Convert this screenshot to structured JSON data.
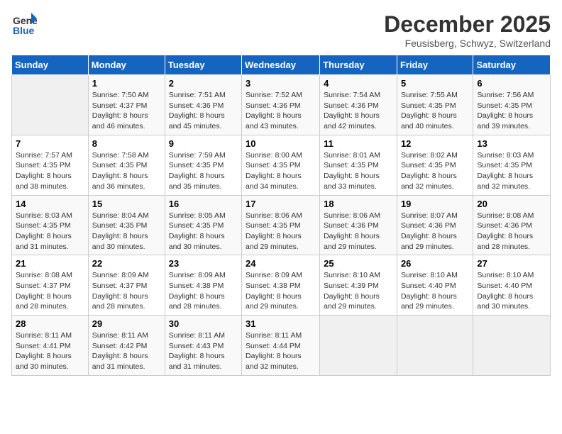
{
  "header": {
    "logo_general": "General",
    "logo_blue": "Blue",
    "month": "December 2025",
    "location": "Feusisberg, Schwyz, Switzerland"
  },
  "days_of_week": [
    "Sunday",
    "Monday",
    "Tuesday",
    "Wednesday",
    "Thursday",
    "Friday",
    "Saturday"
  ],
  "weeks": [
    [
      {
        "day": "",
        "info": ""
      },
      {
        "day": "1",
        "info": "Sunrise: 7:50 AM\nSunset: 4:37 PM\nDaylight: 8 hours\nand 46 minutes."
      },
      {
        "day": "2",
        "info": "Sunrise: 7:51 AM\nSunset: 4:36 PM\nDaylight: 8 hours\nand 45 minutes."
      },
      {
        "day": "3",
        "info": "Sunrise: 7:52 AM\nSunset: 4:36 PM\nDaylight: 8 hours\nand 43 minutes."
      },
      {
        "day": "4",
        "info": "Sunrise: 7:54 AM\nSunset: 4:36 PM\nDaylight: 8 hours\nand 42 minutes."
      },
      {
        "day": "5",
        "info": "Sunrise: 7:55 AM\nSunset: 4:35 PM\nDaylight: 8 hours\nand 40 minutes."
      },
      {
        "day": "6",
        "info": "Sunrise: 7:56 AM\nSunset: 4:35 PM\nDaylight: 8 hours\nand 39 minutes."
      }
    ],
    [
      {
        "day": "7",
        "info": "Sunrise: 7:57 AM\nSunset: 4:35 PM\nDaylight: 8 hours\nand 38 minutes."
      },
      {
        "day": "8",
        "info": "Sunrise: 7:58 AM\nSunset: 4:35 PM\nDaylight: 8 hours\nand 36 minutes."
      },
      {
        "day": "9",
        "info": "Sunrise: 7:59 AM\nSunset: 4:35 PM\nDaylight: 8 hours\nand 35 minutes."
      },
      {
        "day": "10",
        "info": "Sunrise: 8:00 AM\nSunset: 4:35 PM\nDaylight: 8 hours\nand 34 minutes."
      },
      {
        "day": "11",
        "info": "Sunrise: 8:01 AM\nSunset: 4:35 PM\nDaylight: 8 hours\nand 33 minutes."
      },
      {
        "day": "12",
        "info": "Sunrise: 8:02 AM\nSunset: 4:35 PM\nDaylight: 8 hours\nand 32 minutes."
      },
      {
        "day": "13",
        "info": "Sunrise: 8:03 AM\nSunset: 4:35 PM\nDaylight: 8 hours\nand 32 minutes."
      }
    ],
    [
      {
        "day": "14",
        "info": "Sunrise: 8:03 AM\nSunset: 4:35 PM\nDaylight: 8 hours\nand 31 minutes."
      },
      {
        "day": "15",
        "info": "Sunrise: 8:04 AM\nSunset: 4:35 PM\nDaylight: 8 hours\nand 30 minutes."
      },
      {
        "day": "16",
        "info": "Sunrise: 8:05 AM\nSunset: 4:35 PM\nDaylight: 8 hours\nand 30 minutes."
      },
      {
        "day": "17",
        "info": "Sunrise: 8:06 AM\nSunset: 4:35 PM\nDaylight: 8 hours\nand 29 minutes."
      },
      {
        "day": "18",
        "info": "Sunrise: 8:06 AM\nSunset: 4:36 PM\nDaylight: 8 hours\nand 29 minutes."
      },
      {
        "day": "19",
        "info": "Sunrise: 8:07 AM\nSunset: 4:36 PM\nDaylight: 8 hours\nand 29 minutes."
      },
      {
        "day": "20",
        "info": "Sunrise: 8:08 AM\nSunset: 4:36 PM\nDaylight: 8 hours\nand 28 minutes."
      }
    ],
    [
      {
        "day": "21",
        "info": "Sunrise: 8:08 AM\nSunset: 4:37 PM\nDaylight: 8 hours\nand 28 minutes."
      },
      {
        "day": "22",
        "info": "Sunrise: 8:09 AM\nSunset: 4:37 PM\nDaylight: 8 hours\nand 28 minutes."
      },
      {
        "day": "23",
        "info": "Sunrise: 8:09 AM\nSunset: 4:38 PM\nDaylight: 8 hours\nand 28 minutes."
      },
      {
        "day": "24",
        "info": "Sunrise: 8:09 AM\nSunset: 4:38 PM\nDaylight: 8 hours\nand 29 minutes."
      },
      {
        "day": "25",
        "info": "Sunrise: 8:10 AM\nSunset: 4:39 PM\nDaylight: 8 hours\nand 29 minutes."
      },
      {
        "day": "26",
        "info": "Sunrise: 8:10 AM\nSunset: 4:40 PM\nDaylight: 8 hours\nand 29 minutes."
      },
      {
        "day": "27",
        "info": "Sunrise: 8:10 AM\nSunset: 4:40 PM\nDaylight: 8 hours\nand 30 minutes."
      }
    ],
    [
      {
        "day": "28",
        "info": "Sunrise: 8:11 AM\nSunset: 4:41 PM\nDaylight: 8 hours\nand 30 minutes."
      },
      {
        "day": "29",
        "info": "Sunrise: 8:11 AM\nSunset: 4:42 PM\nDaylight: 8 hours\nand 31 minutes."
      },
      {
        "day": "30",
        "info": "Sunrise: 8:11 AM\nSunset: 4:43 PM\nDaylight: 8 hours\nand 31 minutes."
      },
      {
        "day": "31",
        "info": "Sunrise: 8:11 AM\nSunset: 4:44 PM\nDaylight: 8 hours\nand 32 minutes."
      },
      {
        "day": "",
        "info": ""
      },
      {
        "day": "",
        "info": ""
      },
      {
        "day": "",
        "info": ""
      }
    ]
  ]
}
